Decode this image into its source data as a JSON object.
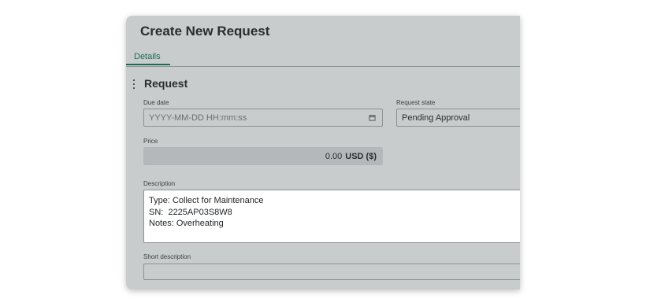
{
  "dialog": {
    "title": "Create New Request",
    "tabs": [
      {
        "label": "Details",
        "active": true
      }
    ]
  },
  "section": {
    "title": "Request"
  },
  "fields": {
    "due_date": {
      "label": "Due date",
      "placeholder": "YYYY-MM-DD HH:mm:ss",
      "icon": "calendar-icon"
    },
    "request_state": {
      "label": "Request state",
      "value": "Pending Approval"
    },
    "price": {
      "label": "Price",
      "value": "0.00",
      "currency": "USD ($)"
    },
    "description": {
      "label": "Description",
      "lines": [
        "Type: Collect for Maintenance",
        "SN:  2225AP03S8W8",
        "Notes: Overheating"
      ]
    },
    "short_description": {
      "label": "Short description",
      "value": ""
    }
  },
  "colors": {
    "panel": "#c9cccd",
    "accent": "#1d6b55",
    "text": "#2a2d30"
  }
}
